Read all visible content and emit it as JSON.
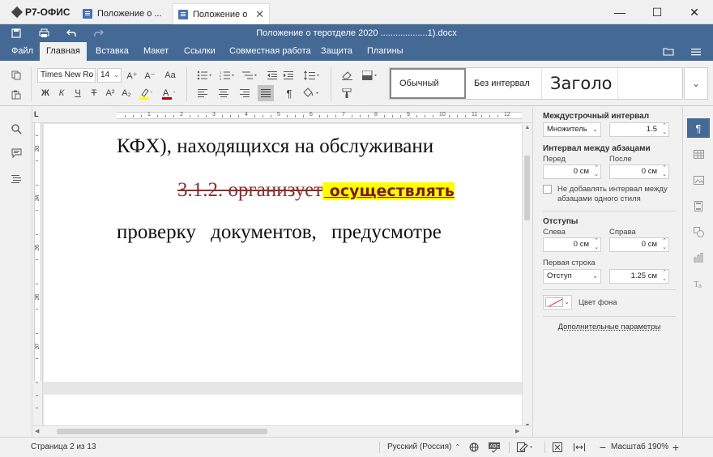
{
  "app": {
    "name": "Р7-ОФИС"
  },
  "tabs": [
    {
      "label": "Положение о ..."
    },
    {
      "label": "Положение о ...",
      "close": "✕"
    }
  ],
  "window": {
    "minimize": "—",
    "maximize": "☐",
    "close": "✕"
  },
  "header": {
    "title": "Положение о теротделе 2020 ...................1).docx"
  },
  "menu": {
    "items": [
      "Файл",
      "Главная",
      "Вставка",
      "Макет",
      "Ссылки",
      "Совместная работа",
      "Защита",
      "Плагины"
    ],
    "active": "Главная"
  },
  "toolbar": {
    "font_name": "Times New Ro",
    "font_size": "14",
    "bold": "Ж",
    "italic": "К",
    "underline": "Ч",
    "strike": "Т",
    "superscript": "A²",
    "subscript": "A₂",
    "grow_font": "A⁺",
    "shrink_font": "A⁻",
    "change_case": "Aa",
    "highlight_color": "#ffff00",
    "font_color": "#c00000",
    "styles": {
      "normal": "Обычный",
      "no_spacing": "Без интервал",
      "heading": "Заголо"
    }
  },
  "document": {
    "line1": "КФХ), находящихся на обслуживани",
    "line2_deleted": "3.1.2.    организует",
    "line2_inserted": " осуществлять ",
    "line3": "проверку документов, предусмотре",
    "ruler_h_numbers": [
      "1",
      "2",
      "3",
      "4",
      "5",
      "6",
      "7",
      "8",
      "9",
      "10",
      "11",
      "12"
    ],
    "ruler_v_numbers": [
      "23",
      "24",
      "25",
      "26",
      "27"
    ]
  },
  "panel": {
    "line_spacing_label": "Междустрочный интервал",
    "line_spacing_type": "Множитель",
    "line_spacing_value": "1.5",
    "para_spacing_label": "Интервал между абзацами",
    "before_label": "Перед",
    "after_label": "После",
    "before_value": "0 см",
    "after_value": "0 см",
    "no_space_checkbox": "Не добавлять интервал между абзацами одного стиля",
    "indents_label": "Отступы",
    "left_label": "Слева",
    "right_label": "Справа",
    "left_value": "0 см",
    "right_value": "0 см",
    "first_line_label": "Первая строка",
    "first_line_type": "Отступ",
    "first_line_value": "1.25 см",
    "bg_color_label": "Цвет фона",
    "advanced_link": "Дополнительные параметры"
  },
  "status": {
    "page": "Страница 2 из 13",
    "language": "Русский (Россия)",
    "zoom": "Масштаб 190%"
  }
}
